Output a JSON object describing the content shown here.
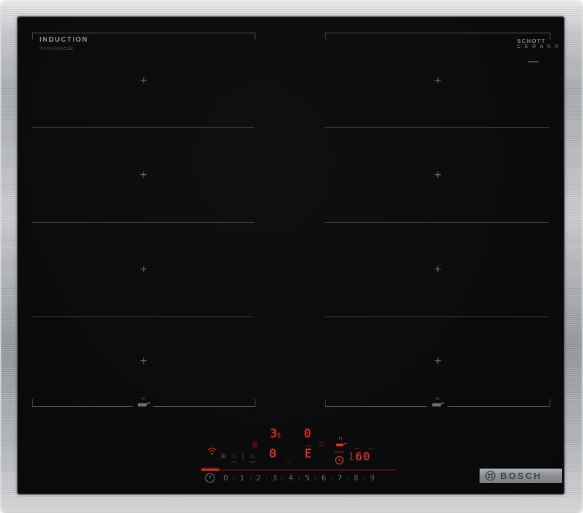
{
  "device": {
    "zone_label": "INDUCTION",
    "model_text": "PXX675DC1E",
    "glass_brand": {
      "line1": "SCHOTT",
      "line2": "C E R A N ®"
    },
    "logo_text": "BOSCH"
  },
  "zones": {
    "plus_mark": "+"
  },
  "control_panel": {
    "display_top_left": "3",
    "display_top_left_sub": "5",
    "display_top_right": "0",
    "display_bottom_left": "0",
    "display_bottom_right": "E",
    "star_indicator": "☆",
    "timer": {
      "dim_digit": "1",
      "bright_digits": "60"
    },
    "icon_cluster": [
      "⊞",
      "♨",
      "|",
      "⚠"
    ],
    "power_levels": [
      "0",
      "1",
      "2",
      "3",
      "4",
      "5",
      "6",
      "7",
      "8",
      "9"
    ],
    "colors": {
      "led_red": "#e23a2b",
      "dim_red": "#4c130c",
      "accent_line": "#c5352a"
    }
  }
}
